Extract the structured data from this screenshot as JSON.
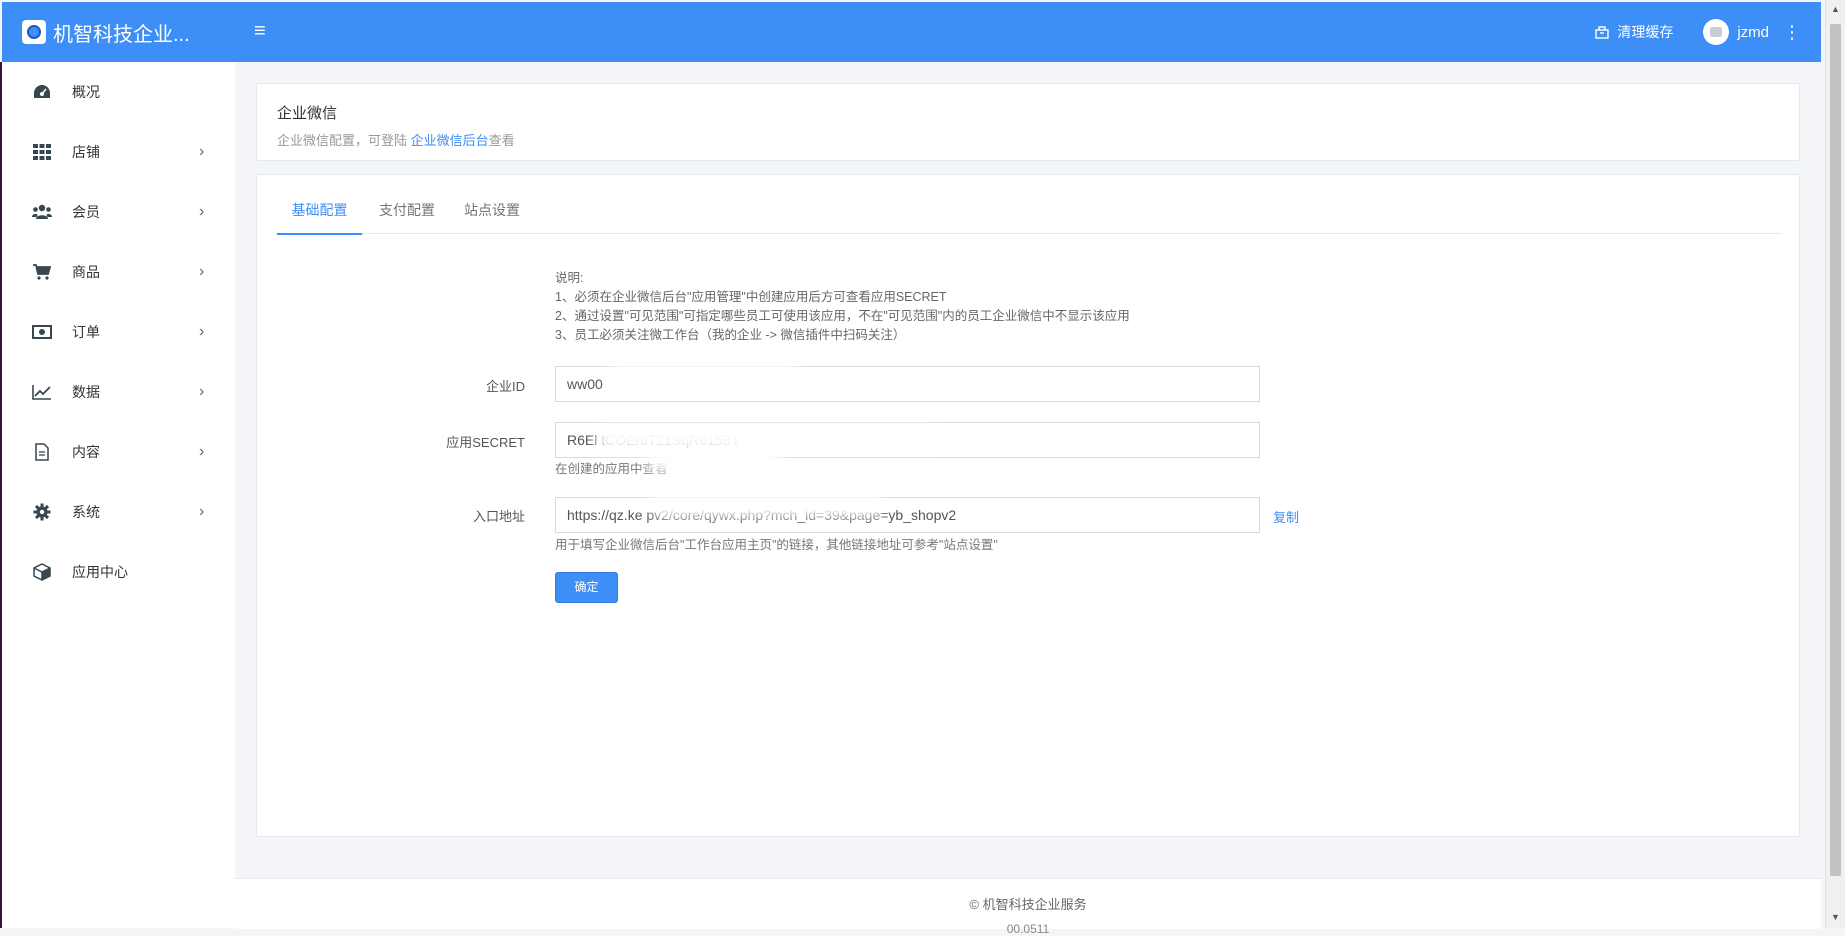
{
  "header": {
    "brand_title": "机智科技企业...",
    "clear_cache": "清理缓存",
    "username": "jzmd"
  },
  "sidebar": {
    "items": [
      {
        "label": "概况",
        "icon": "dashboard-icon",
        "has_submenu": false
      },
      {
        "label": "店铺",
        "icon": "grid-icon",
        "has_submenu": true
      },
      {
        "label": "会员",
        "icon": "users-icon",
        "has_submenu": true
      },
      {
        "label": "商品",
        "icon": "cart-icon",
        "has_submenu": true
      },
      {
        "label": "订单",
        "icon": "money-icon",
        "has_submenu": true
      },
      {
        "label": "数据",
        "icon": "line-chart-icon",
        "has_submenu": true
      },
      {
        "label": "内容",
        "icon": "document-icon",
        "has_submenu": true
      },
      {
        "label": "系统",
        "icon": "gear-icon",
        "has_submenu": true
      },
      {
        "label": "应用中心",
        "icon": "cube-icon",
        "has_submenu": false
      }
    ]
  },
  "page": {
    "title": "企业微信",
    "subtitle_prefix": "企业微信配置，可登陆",
    "subtitle_link": "企业微信后台",
    "subtitle_suffix": "查看"
  },
  "tabs": [
    {
      "label": "基础配置",
      "active": true
    },
    {
      "label": "支付配置",
      "active": false
    },
    {
      "label": "站点设置",
      "active": false
    }
  ],
  "form": {
    "note_lines": [
      "说明:",
      "1、必须在企业微信后台\"应用管理\"中创建应用后方可查看应用SECRET",
      "2、通过设置\"可见范围\"可指定哪些员工可使用该应用，不在\"可见范围\"内的员工企业微信中不显示该应用",
      "3、员工必须关注微工作台（我的企业 -> 微信插件中扫码关注）"
    ],
    "corp_id_label": "企业ID",
    "corp_id_value": "ww00",
    "secret_label": "应用SECRET",
    "secret_value": "R6El           tCOEruT21SqR0158 l",
    "secret_help": "在创建的应用中查看",
    "entry_label": "入口地址",
    "entry_value": "https://qz.ke                                              pv2/core/qywx.php?mch_id=39&page=yb_shopv2",
    "copy_label": "复制",
    "entry_help": "用于填写企业微信后台\"工作台应用主页\"的链接，其他链接地址可参考\"站点设置\"",
    "submit_label": "确定"
  },
  "footer": {
    "copyright": "© 机智科技企业服务",
    "second_line": "00.0511"
  },
  "colors": {
    "primary": "#3e8ef7",
    "background": "#f4f5f8"
  }
}
